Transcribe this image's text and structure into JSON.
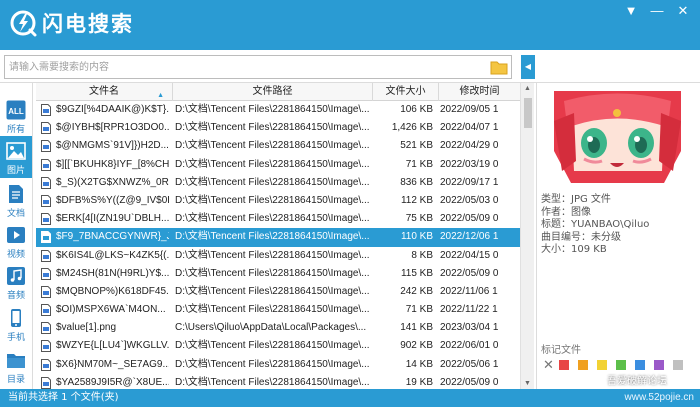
{
  "app": {
    "title": "闪电搜索"
  },
  "window": {
    "menu_glyph": "▼",
    "minimize_glyph": "—",
    "close_glyph": "✕"
  },
  "search": {
    "placeholder": "请输入需要搜索的内容",
    "value": "",
    "collapse_glyph": "◀"
  },
  "sidebar": {
    "items": [
      {
        "label": "所有",
        "icon": "all-icon",
        "active": false
      },
      {
        "label": "图片",
        "icon": "image-icon",
        "active": true
      },
      {
        "label": "文档",
        "icon": "document-icon",
        "active": false
      },
      {
        "label": "视频",
        "icon": "video-icon",
        "active": false
      },
      {
        "label": "音频",
        "icon": "audio-icon",
        "active": false
      },
      {
        "label": "手机",
        "icon": "phone-icon",
        "active": false
      },
      {
        "label": "目录",
        "icon": "folder-icon",
        "active": false
      }
    ],
    "all_icon_text": "ALL"
  },
  "table": {
    "columns": [
      "文件名",
      "文件路径",
      "文件大小",
      "修改时间"
    ],
    "sort_glyph": "▲",
    "selected_index": 7,
    "rows": [
      {
        "name": "$9GZI[%4DAAIK@)K$T}...",
        "path": "D:\\文档\\Tencent Files\\2281864150\\Image\\...",
        "size": "106 KB",
        "date": "2022/09/05 1"
      },
      {
        "name": "$@IYBH$[RPR1O3DO0...",
        "path": "D:\\文档\\Tencent Files\\2281864150\\Image\\...",
        "size": "1,426 KB",
        "date": "2022/04/07 1"
      },
      {
        "name": "$@NMGMS`91V]})H2D...",
        "path": "D:\\文档\\Tencent Files\\2281864150\\Image\\...",
        "size": "521 KB",
        "date": "2022/04/29 0"
      },
      {
        "name": "$][[`BKUHK8}IYF_[8%CH...",
        "path": "D:\\文档\\Tencent Files\\2281864150\\Image\\...",
        "size": "71 KB",
        "date": "2022/03/19 0"
      },
      {
        "name": "$_S)(X2TG$XNWZ%_0R(...",
        "path": "D:\\文档\\Tencent Files\\2281864150\\Image\\...",
        "size": "836 KB",
        "date": "2022/09/17 1"
      },
      {
        "name": "$DFB%S%Y((Z@9_IV$0F...",
        "path": "D:\\文档\\Tencent Files\\2281864150\\Image\\...",
        "size": "112 KB",
        "date": "2022/05/03 0"
      },
      {
        "name": "$ERK[4[I(ZN19U`DBLH...",
        "path": "D:\\文档\\Tencent Files\\2281864150\\Image\\...",
        "size": "75 KB",
        "date": "2022/05/09 0"
      },
      {
        "name": "$F9_7BNACCGYNWR}_J...",
        "path": "D:\\文档\\Tencent Files\\2281864150\\Image\\...",
        "size": "110 KB",
        "date": "2022/12/06 1"
      },
      {
        "name": "$K6IS4L@LKS~K4ZK5{(...",
        "path": "D:\\文档\\Tencent Files\\2281864150\\Image\\...",
        "size": "8 KB",
        "date": "2022/04/15 0"
      },
      {
        "name": "$M24SH(81N(H9RL)Y$...",
        "path": "D:\\文档\\Tencent Files\\2281864150\\Image\\...",
        "size": "115 KB",
        "date": "2022/05/09 0"
      },
      {
        "name": "$MQBNOP%)K618DF45...",
        "path": "D:\\文档\\Tencent Files\\2281864150\\Image\\...",
        "size": "242 KB",
        "date": "2022/11/06 1"
      },
      {
        "name": "$OI)MSPX6WA`M4ON...",
        "path": "D:\\文档\\Tencent Files\\2281864150\\Image\\...",
        "size": "71 KB",
        "date": "2022/11/22 1"
      },
      {
        "name": "$value[1].png",
        "path": "C:\\Users\\Qiluo\\AppData\\Local\\Packages\\...",
        "size": "141 KB",
        "date": "2023/03/04 1"
      },
      {
        "name": "$WZYE{L[LU4`]WKGLLV...",
        "path": "D:\\文档\\Tencent Files\\2281864150\\Image\\...",
        "size": "902 KB",
        "date": "2022/06/01 0"
      },
      {
        "name": "$X6}NM70M~_SE7AG9...",
        "path": "D:\\文档\\Tencent Files\\2281864150\\Image\\...",
        "size": "14 KB",
        "date": "2022/05/06 1"
      },
      {
        "name": "$YA2589J9I5R@`X8UE...",
        "path": "D:\\文档\\Tencent Files\\2281864150\\Image\\...",
        "size": "19 KB",
        "date": "2022/05/09 0"
      }
    ]
  },
  "details": {
    "type_line": "类型：JPG 文件",
    "author_line": "作者：图像",
    "title_line": "标题：YUANBAO\\Qiluo",
    "track_line": "曲目编号：未分级",
    "size_line": "大小：109 KB",
    "mark_label": "标记文件",
    "mark_clear_glyph": "✕",
    "mark_colors": [
      "#e84545",
      "#f0a020",
      "#f2d234",
      "#5cbf4a",
      "#3b8ee0",
      "#9b59c9",
      "#c0c0c0"
    ]
  },
  "status": {
    "text": "当前共选择 1 个文件(夹)",
    "watermark_top": "吾爱破解论坛",
    "watermark": "www.52pojie.cn"
  }
}
